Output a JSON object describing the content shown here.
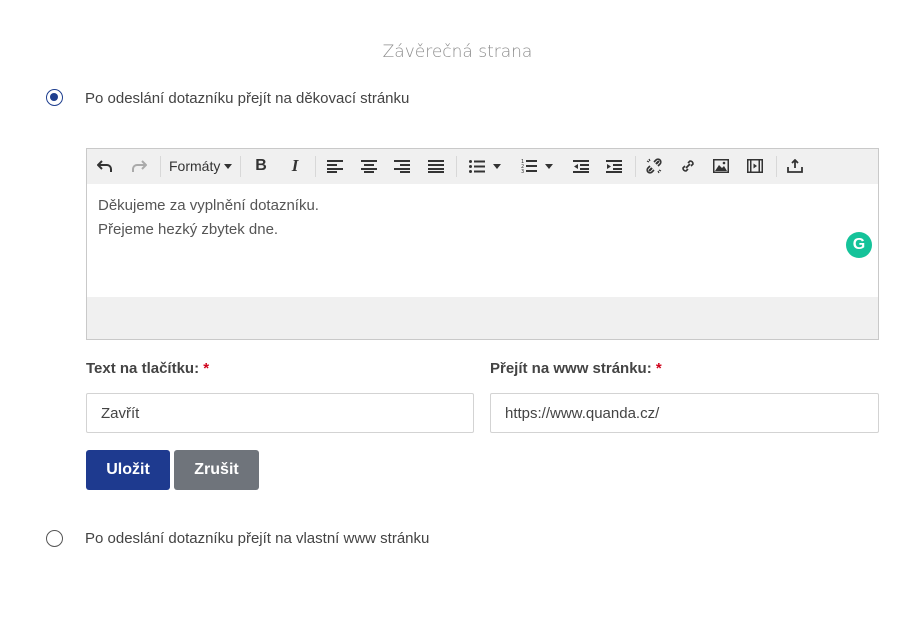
{
  "page": {
    "title": "Závěrečná strana"
  },
  "option_thankyou": {
    "label": "Po odeslání dotazníku přejít na děkovací stránku",
    "selected": true
  },
  "editor": {
    "toolbar": {
      "formats_label": "Formáty"
    },
    "content_lines": [
      "Děkujeme za vyplnění dotazníku.",
      "Přejeme hezký zbytek dne."
    ],
    "grammarly_letter": "G"
  },
  "form": {
    "button_text_label": "Text na tlačítku:",
    "button_text_value": "Zavřít",
    "url_label": "Přejít na www stránku:",
    "url_value": "https://www.quanda.cz/",
    "required_mark": "*"
  },
  "actions": {
    "save_label": "Uložit",
    "cancel_label": "Zrušit"
  },
  "option_custom_url": {
    "label": "Po odeslání dotazníku přejít na vlastní www stránku",
    "selected": false
  },
  "colors": {
    "primary": "#1e3a8f",
    "secondary": "#6f747b",
    "required": "#d0021b",
    "grammarly": "#15c39a"
  }
}
